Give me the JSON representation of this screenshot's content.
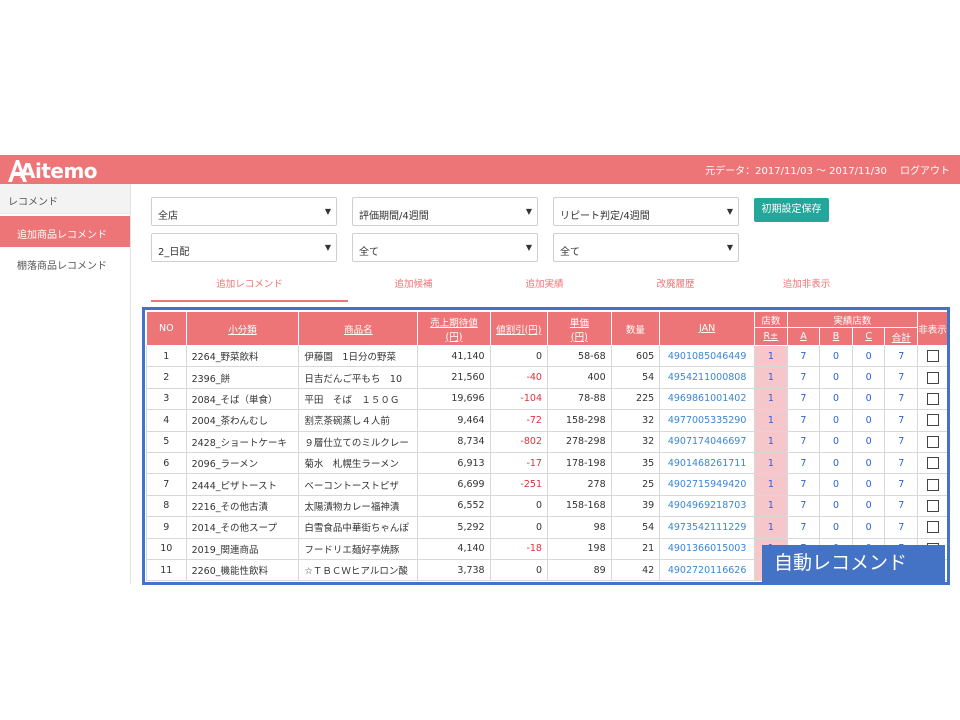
{
  "app": {
    "logo_text": "Aitemo",
    "data_range": "元データ：2017/11/03 〜 2017/11/30",
    "logout": "ログアウト",
    "brand_color": "#ee7577"
  },
  "sidebar": {
    "header": "レコメンド",
    "items": [
      {
        "label": "追加商品レコメンド",
        "active": true
      },
      {
        "label": "棚落商品レコメンド",
        "active": false
      }
    ]
  },
  "filters": {
    "row1": [
      "全店",
      "評価期間/4週間",
      "リピート判定/4週間"
    ],
    "row2": [
      "2_日配",
      "全て",
      "全て"
    ],
    "save_button": "初期設定保存"
  },
  "tabs": [
    "追加レコメンド",
    "追加候補",
    "追加実績",
    "改廃履歴",
    "追加非表示"
  ],
  "table": {
    "headers": {
      "no": "NO",
      "category": "小分類",
      "product": "商品名",
      "expected": "売上期待値",
      "expected_unit": "(円)",
      "discount": "値割引(円)",
      "price": "単価",
      "price_unit": "(円)",
      "qty": "数量",
      "jan": "JAN",
      "stores": "店数",
      "stores_r": "R±",
      "actual_stores": "実績店数",
      "a": "A",
      "b": "B",
      "c": "C",
      "total": "合計",
      "hide": "非表示"
    },
    "rows": [
      {
        "no": "1",
        "category": "2264_野菜飲料",
        "product": "伊藤園　1日分の野菜",
        "expected": "41,140",
        "discount": "0",
        "price": "58-68",
        "qty": "605",
        "jan": "4901085046449",
        "r": "1",
        "a": "7",
        "b": "0",
        "c": "0",
        "total": "7"
      },
      {
        "no": "2",
        "category": "2396_餅",
        "product": "日吉だんご平もち　10",
        "expected": "21,560",
        "discount": "-40",
        "price": "400",
        "qty": "54",
        "jan": "4954211000808",
        "r": "1",
        "a": "7",
        "b": "0",
        "c": "0",
        "total": "7"
      },
      {
        "no": "3",
        "category": "2084_そば（単食）",
        "product": "平田　そば　１５０Ｇ",
        "expected": "19,696",
        "discount": "-104",
        "price": "78-88",
        "qty": "225",
        "jan": "4969861001402",
        "r": "1",
        "a": "7",
        "b": "0",
        "c": "0",
        "total": "7"
      },
      {
        "no": "4",
        "category": "2004_茶わんむし",
        "product": "割烹茶碗蒸し４人前",
        "expected": "9,464",
        "discount": "-72",
        "price": "158-298",
        "qty": "32",
        "jan": "4977005335290",
        "r": "1",
        "a": "7",
        "b": "0",
        "c": "0",
        "total": "7"
      },
      {
        "no": "5",
        "category": "2428_ショートケーキ",
        "product": "９層仕立てのミルクレー",
        "expected": "8,734",
        "discount": "-802",
        "price": "278-298",
        "qty": "32",
        "jan": "4907174046697",
        "r": "1",
        "a": "7",
        "b": "0",
        "c": "0",
        "total": "7"
      },
      {
        "no": "6",
        "category": "2096_ラーメン",
        "product": "菊水　札幌生ラーメン",
        "expected": "6,913",
        "discount": "-17",
        "price": "178-198",
        "qty": "35",
        "jan": "4901468261711",
        "r": "1",
        "a": "7",
        "b": "0",
        "c": "0",
        "total": "7"
      },
      {
        "no": "7",
        "category": "2444_ピザトースト",
        "product": "ベーコントーストピザ",
        "expected": "6,699",
        "discount": "-251",
        "price": "278",
        "qty": "25",
        "jan": "4902715949420",
        "r": "1",
        "a": "7",
        "b": "0",
        "c": "0",
        "total": "7"
      },
      {
        "no": "8",
        "category": "2216_その他古漬",
        "product": "太陽漬物カレー福神漬",
        "expected": "6,552",
        "discount": "0",
        "price": "158-168",
        "qty": "39",
        "jan": "4904969218703",
        "r": "1",
        "a": "7",
        "b": "0",
        "c": "0",
        "total": "7"
      },
      {
        "no": "9",
        "category": "2014_その他スープ",
        "product": "白雪食品中華街ちゃんぽ",
        "expected": "5,292",
        "discount": "0",
        "price": "98",
        "qty": "54",
        "jan": "4973542111229",
        "r": "1",
        "a": "7",
        "b": "0",
        "c": "0",
        "total": "7"
      },
      {
        "no": "10",
        "category": "2019_関連商品",
        "product": "フードリエ麺好亭焼豚",
        "expected": "4,140",
        "discount": "-18",
        "price": "198",
        "qty": "21",
        "jan": "4901366015003",
        "r": "1",
        "a": "7",
        "b": "0",
        "c": "0",
        "total": "7"
      },
      {
        "no": "11",
        "category": "2260_機能性飲料",
        "product": "☆ＴＢＣＷヒアルロン酸",
        "expected": "3,738",
        "discount": "0",
        "price": "89",
        "qty": "42",
        "jan": "4902720116626",
        "r": "1",
        "a": "7",
        "b": "0",
        "c": "0",
        "total": "7"
      }
    ]
  },
  "overlay_label": "自動レコメンド"
}
